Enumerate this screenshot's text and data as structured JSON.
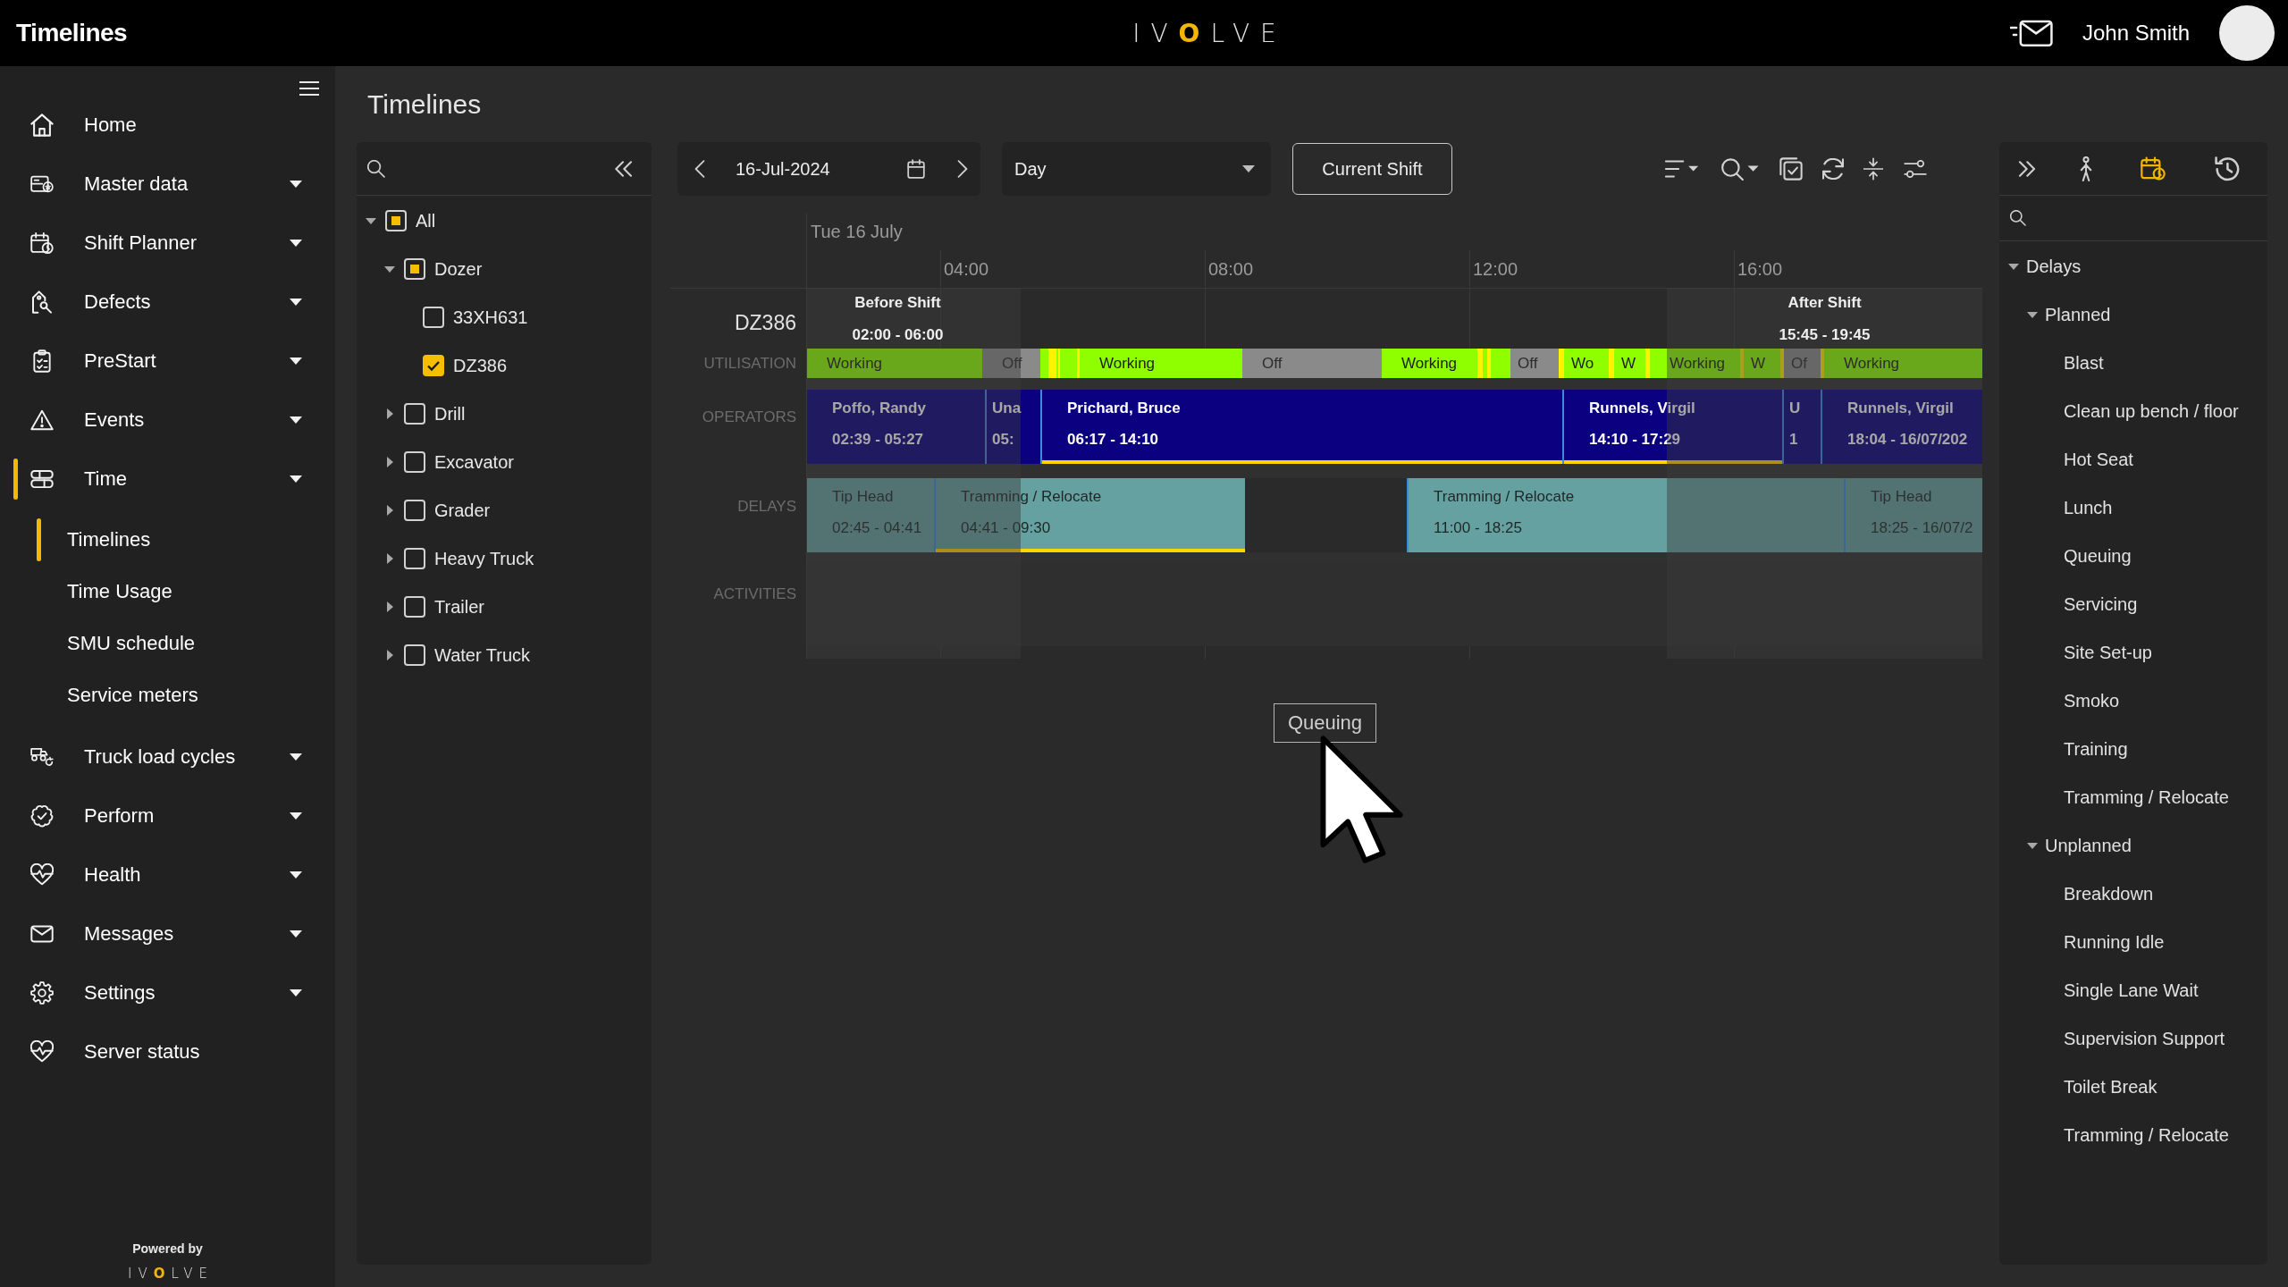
{
  "top_bar": {
    "title": "Timelines",
    "logo": "IVOLVE",
    "user_name": "John Smith"
  },
  "nav": [
    {
      "label": "Home",
      "kind": "link",
      "selected": false
    },
    {
      "label": "Master data",
      "kind": "menu",
      "selected": false
    },
    {
      "label": "Shift Planner",
      "kind": "menu",
      "selected": false
    },
    {
      "label": "Defects",
      "kind": "menu",
      "selected": false
    },
    {
      "label": "PreStart",
      "kind": "menu",
      "selected": false
    },
    {
      "label": "Events",
      "kind": "menu",
      "selected": false
    },
    {
      "label": "Time",
      "kind": "menu",
      "selected": true,
      "children": [
        {
          "label": "Timelines",
          "selected": true
        },
        {
          "label": "Time Usage",
          "selected": false
        },
        {
          "label": "SMU schedule",
          "selected": false
        },
        {
          "label": "Service meters",
          "selected": false
        }
      ]
    },
    {
      "label": "Truck load cycles",
      "kind": "menu",
      "selected": false
    },
    {
      "label": "Perform",
      "kind": "menu",
      "selected": false
    },
    {
      "label": "Health",
      "kind": "menu",
      "selected": false
    },
    {
      "label": "Messages",
      "kind": "menu",
      "selected": false
    },
    {
      "label": "Settings",
      "kind": "menu",
      "selected": false
    },
    {
      "label": "Server status",
      "kind": "link",
      "selected": false
    }
  ],
  "sidebar_footer": {
    "powered_by": "Powered by",
    "logo": "IVOLVE"
  },
  "page_title": "Timelines",
  "equipment_tree": [
    {
      "label": "All",
      "expanded": true,
      "checked": false,
      "indeterminate": true,
      "children": [
        {
          "label": "Dozer",
          "expanded": true,
          "checked": false,
          "indeterminate": true,
          "children": [
            {
              "label": "33XH631",
              "checked": false,
              "indeterminate": false
            },
            {
              "label": "DZ386",
              "checked": true,
              "indeterminate": false
            }
          ]
        },
        {
          "label": "Drill",
          "expanded": false,
          "checked": false,
          "indeterminate": false
        },
        {
          "label": "Excavator",
          "expanded": false,
          "checked": false,
          "indeterminate": false
        },
        {
          "label": "Grader",
          "expanded": false,
          "checked": false,
          "indeterminate": false
        },
        {
          "label": "Heavy Truck",
          "expanded": false,
          "checked": false,
          "indeterminate": false
        },
        {
          "label": "Trailer",
          "expanded": false,
          "checked": false,
          "indeterminate": false
        },
        {
          "label": "Water Truck",
          "expanded": false,
          "checked": false,
          "indeterminate": false
        }
      ]
    }
  ],
  "toolbar": {
    "date": "16-Jul-2024",
    "view": "Day",
    "current_shift_button": "Current Shift"
  },
  "timeline": {
    "date_heading": "Tue 16 July",
    "ticks": [
      "04:00",
      "08:00",
      "12:00",
      "16:00"
    ],
    "equipment": "DZ386",
    "shifts": [
      {
        "label": "Before Shift",
        "time": "02:00 - 06:00"
      },
      {
        "label": "After Shift",
        "time": "15:45 - 19:45"
      }
    ],
    "utilisation": {
      "label": "UTILISATION",
      "segments": [
        {
          "kind": "working",
          "label": "Working"
        },
        {
          "kind": "off",
          "label": "Off"
        },
        {
          "kind": "working"
        },
        {
          "kind": "event"
        },
        {
          "kind": "working"
        },
        {
          "kind": "event"
        },
        {
          "kind": "working"
        },
        {
          "kind": "event"
        },
        {
          "kind": "working",
          "label": "Working"
        },
        {
          "kind": "off",
          "label": "Off"
        },
        {
          "kind": "working",
          "label": "Working"
        },
        {
          "kind": "event"
        },
        {
          "kind": "working"
        },
        {
          "kind": "event"
        },
        {
          "kind": "working"
        },
        {
          "kind": "off",
          "label": "Off"
        },
        {
          "kind": "event"
        },
        {
          "kind": "working",
          "label": "Wo"
        },
        {
          "kind": "event"
        },
        {
          "kind": "working",
          "label": "W"
        },
        {
          "kind": "event"
        },
        {
          "kind": "working",
          "label": "Working"
        },
        {
          "kind": "event"
        },
        {
          "kind": "working",
          "label": "W"
        },
        {
          "kind": "event"
        },
        {
          "kind": "off",
          "label": "Of"
        },
        {
          "kind": "event"
        },
        {
          "kind": "working",
          "label": "Working"
        }
      ]
    },
    "operators": {
      "label": "OPERATORS",
      "segments": [
        {
          "name": "Poffo, Randy",
          "time": "02:39 - 05:27",
          "highlighted": false
        },
        {
          "name": "Una",
          "time": "05:",
          "highlighted": false
        },
        {
          "name": "Prichard, Bruce",
          "time": "06:17 - 14:10",
          "highlighted": true
        },
        {
          "name": "Runnels, Virgil",
          "time": "14:10 - 17:29",
          "highlighted": true
        },
        {
          "name": "U",
          "time": "1",
          "highlighted": false
        },
        {
          "name": "Runnels, Virgil",
          "time": "18:04 - 16/07/202",
          "highlighted": false
        }
      ]
    },
    "delays": {
      "label": "DELAYS",
      "segments": [
        {
          "name": "Tip Head",
          "time": "02:45 - 04:41",
          "highlighted": false
        },
        {
          "name": "Tramming / Relocate",
          "time": "04:41 - 09:30",
          "highlighted": true
        },
        {
          "name": "Tramming / Relocate",
          "time": "11:00 - 18:25",
          "highlighted": false
        },
        {
          "name": "Tip Head",
          "time": "18:25 - 16/07/2",
          "highlighted": false
        }
      ]
    },
    "activities": {
      "label": "ACTIVITIES"
    }
  },
  "drag_label": "Queuing",
  "right_panel": {
    "tabs": [
      {
        "selected": false
      },
      {
        "selected": true
      },
      {
        "selected": false
      }
    ],
    "delay_tree": [
      {
        "label": "Delays",
        "expanded": true,
        "children": [
          {
            "label": "Planned",
            "expanded": true,
            "children": [
              {
                "label": "Blast"
              },
              {
                "label": "Clean up bench / floor"
              },
              {
                "label": "Hot Seat"
              },
              {
                "label": "Lunch"
              },
              {
                "label": "Queuing"
              },
              {
                "label": "Servicing"
              },
              {
                "label": "Site Set-up"
              },
              {
                "label": "Smoko"
              },
              {
                "label": "Training"
              },
              {
                "label": "Tramming / Relocate"
              }
            ]
          },
          {
            "label": "Unplanned",
            "expanded": true,
            "children": [
              {
                "label": "Breakdown"
              },
              {
                "label": "Running Idle"
              },
              {
                "label": "Single Lane Wait"
              },
              {
                "label": "Supervision Support"
              },
              {
                "label": "Toilet Break"
              },
              {
                "label": "Tramming / Relocate"
              }
            ]
          }
        ]
      }
    ]
  }
}
